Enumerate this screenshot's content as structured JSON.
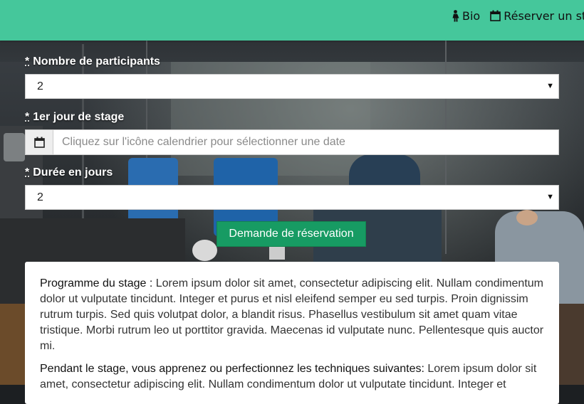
{
  "header": {
    "nav": [
      {
        "icon": "female-icon",
        "label": "Bio"
      },
      {
        "icon": "calendar-icon",
        "label": "Réserver un st"
      }
    ]
  },
  "form": {
    "participants": {
      "required_mark": "*",
      "label": "Nombre de participants",
      "value": "2"
    },
    "first_day": {
      "required_mark": "*",
      "label": "1er jour de stage",
      "placeholder": "Cliquez sur l'icône calendrier pour sélectionner une date",
      "icon": "calendar-icon"
    },
    "duration": {
      "required_mark": "*",
      "label": "Durée en jours",
      "value": "2"
    },
    "submit_label": "Demande de réservation"
  },
  "description": {
    "p1_lead": "Programme du stage : ",
    "p1_text": "Lorem ipsum dolor sit amet, consectetur adipiscing elit. Nullam condimentum dolor ut vulputate tincidunt. Integer et purus et nisl eleifend semper eu sed turpis. Proin dignissim rutrum turpis. Sed quis volutpat dolor, a blandit risus. Phasellus vestibulum sit amet quam vitae tristique. Morbi rutrum leo ut porttitor gravida. Maecenas id vulputate nunc. Pellentesque quis auctor mi.",
    "p2_lead": "Pendant le stage, vous apprenez ou perfectionnez les techniques suivantes: ",
    "p2_text": "Lorem ipsum dolor sit amet, consectetur adipiscing elit. Nullam condimentum dolor ut vulputate tincidunt. Integer et"
  }
}
